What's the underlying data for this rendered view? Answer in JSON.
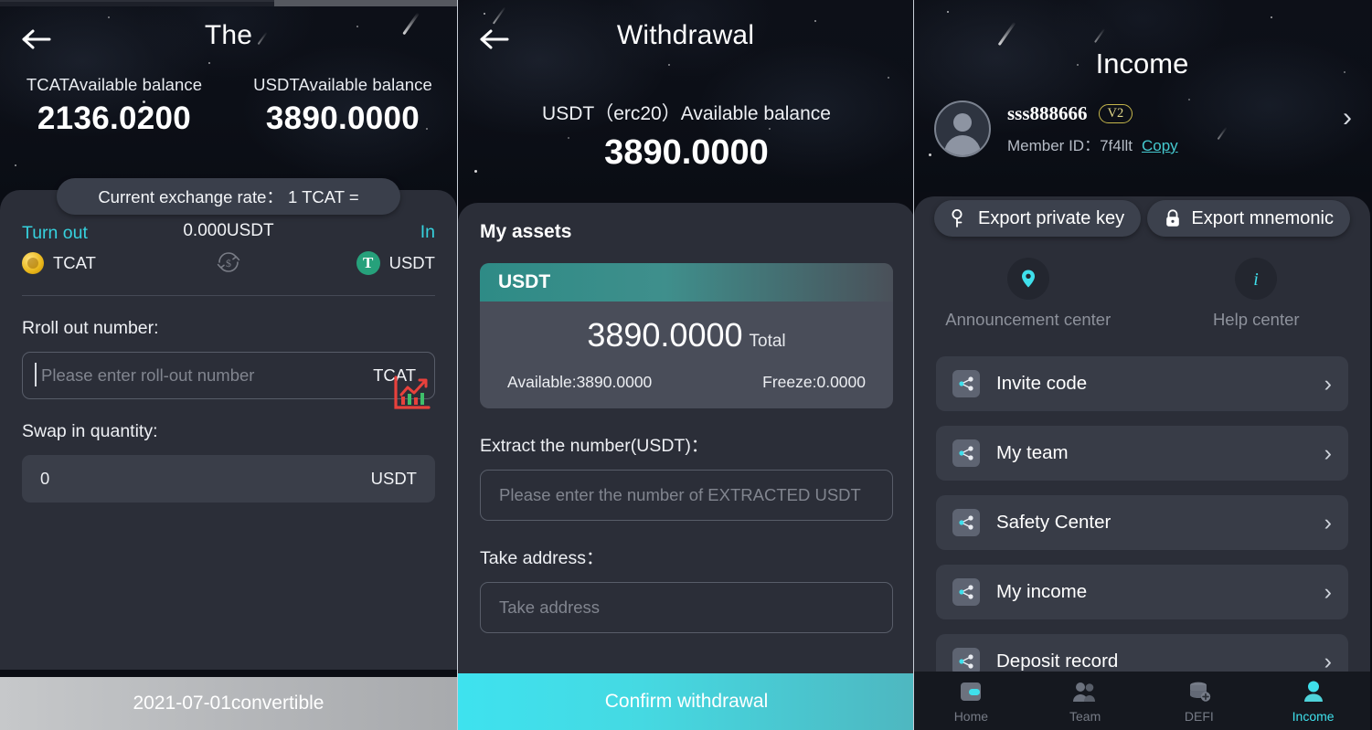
{
  "panel1": {
    "header": {
      "back_icon": "arrow-left-icon",
      "title": "The"
    },
    "balances": [
      {
        "label": "TCATAvailable balance",
        "value": "2136.0200"
      },
      {
        "label": "USDTAvailable balance",
        "value": "3890.0000"
      }
    ],
    "exchange_rate": "Current exchange rate： 1 TCAT =",
    "swap": {
      "out_caption": "Turn out",
      "out_coin": "TCAT",
      "mid_value": "0.000USDT",
      "mid_icon": "swap-circle-icon",
      "in_caption": "In",
      "in_coin": "USDT"
    },
    "roll_out": {
      "label": "Rroll out number:",
      "placeholder": "Please enter roll-out number",
      "unit": "TCAT"
    },
    "swap_in": {
      "label": "Swap in quantity:",
      "value": "0",
      "unit": "USDT"
    },
    "chart_icon": "trend-chart-icon",
    "cta": "2021-07-01convertible"
  },
  "panel2": {
    "header": {
      "back_icon": "arrow-left-icon",
      "title": "Withdrawal"
    },
    "balance_label": "USDT（erc20）Available balance",
    "balance_value": "3890.0000",
    "my_assets_title": "My assets",
    "asset_card": {
      "symbol": "USDT",
      "total_value": "3890.0000",
      "total_label": "Total",
      "available": "Available:3890.0000",
      "freeze": "Freeze:0.0000"
    },
    "extract": {
      "label": "Extract the number(USDT)：",
      "placeholder": "Please enter the number of EXTRACTED USDT"
    },
    "address": {
      "label": "Take address：",
      "placeholder": "Take address"
    },
    "cta": "Confirm withdrawal"
  },
  "panel3": {
    "title": "Income",
    "profile": {
      "avatar_icon": "avatar-icon",
      "username": "sss888666",
      "level_badge": "V2",
      "member_id_label": "Member ID：",
      "member_id": "7f4llt",
      "copy_label": "Copy",
      "chevron": "›"
    },
    "export_buttons": [
      {
        "label": "Export private key",
        "icon": "key-icon"
      },
      {
        "label": "Export mnemonic",
        "icon": "lock-icon"
      }
    ],
    "centers": [
      {
        "label": "Announcement center",
        "icon": "location-pin-icon"
      },
      {
        "label": "Help center",
        "icon": "info-icon"
      }
    ],
    "menu": [
      {
        "label": "Invite code",
        "icon": "share-network-icon",
        "chevron": "›"
      },
      {
        "label": "My team",
        "icon": "share-network-icon",
        "chevron": "›"
      },
      {
        "label": "Safety Center",
        "icon": "share-network-icon",
        "chevron": "›"
      },
      {
        "label": "My income",
        "icon": "share-network-icon",
        "chevron": "›"
      },
      {
        "label": "Deposit record",
        "icon": "share-network-icon",
        "chevron": "›"
      }
    ],
    "tabs": [
      {
        "label": "Home",
        "icon": "wallet-icon",
        "active": false
      },
      {
        "label": "Team",
        "icon": "people-icon",
        "active": false
      },
      {
        "label": "DEFI",
        "icon": "coins-plus-icon",
        "active": false
      },
      {
        "label": "Income",
        "icon": "person-icon",
        "active": true
      }
    ]
  },
  "colors": {
    "accent_cyan": "#3fe0ec",
    "sheet_bg": "#2b2e38",
    "card_bg": "#383c47",
    "usdt_green": "#26a17b",
    "badge_gold": "#e3d98a",
    "chart_red": "#e8413c"
  }
}
